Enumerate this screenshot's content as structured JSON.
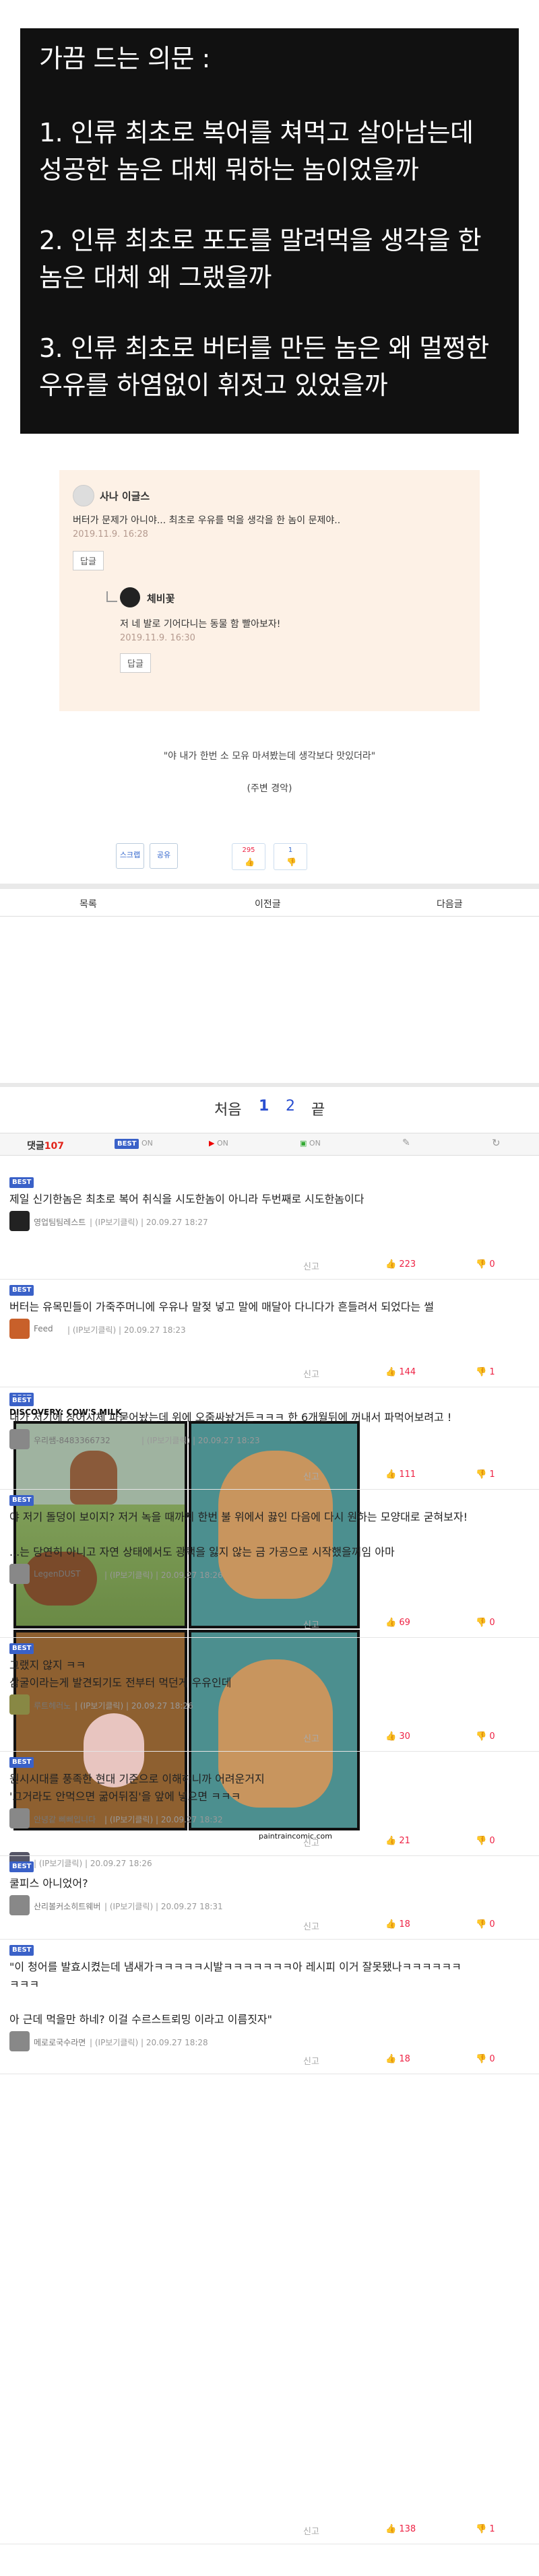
{
  "top_card": {
    "lines": [
      "가끔 드는 의문 :",
      "1. 인류 최초로 복어를 쳐먹고 살아남는데",
      "성공한 놈은 대체 뭐하는 놈이었을까",
      "2. 인류 최초로 포도를 말려먹을 생각을 한",
      "놈은 대체 왜 그랬을까",
      "3. 인류 최초로 버터를 만든 놈은 왜 멀쩡한",
      "우유를 하염없이 휘젓고 있었을까"
    ]
  },
  "comment_box": {
    "c1": {
      "name": "사나 이글스",
      "text": "버터가 문제가 아니야... 최초로 우유를 먹을 생각을 한 놈이 문제야..",
      "date": "2019.11.9. 16:28",
      "reply": "답글"
    },
    "c2": {
      "name": "체비꽃",
      "text": "저 네 발로 기어다니는 동물 함 빨아보자!",
      "date": "2019.11.9. 16:30",
      "reply": "답글"
    }
  },
  "quote": "\"야 내가 한번 소 모유 마셔봤는데 생각보다 맛있더라\"",
  "quote_src": "(주변 경악)",
  "buttons": {
    "scrap": "스크랩",
    "share": "공유",
    "up_count": "295",
    "down_count": "1"
  },
  "nav": {
    "list": "목록",
    "prev": "이전글",
    "next": "다음글"
  },
  "pager": {
    "first": "처음",
    "p1": "1",
    "p2": "2",
    "last": "끝"
  },
  "tabs": {
    "comments_label": "댓글",
    "comments_count": "107",
    "best": "BEST",
    "on1": "ON",
    "on2": "ON",
    "on3": "ON"
  },
  "best_badge": "BEST",
  "report": "신고",
  "comments": [
    {
      "text": "제일 신기한놈은 최초로 복어 취식을 시도한놈이 아니라 두번째로 시도한놈이다",
      "nick": "영업팀팀레스트",
      "meta": "| (IP보기클릭) | 20.09.27 18:27",
      "up": "223",
      "down": "0"
    },
    {
      "text": "버터는 유목민들이 가죽주머니에 우유나 말젖 넣고 말에 매달아 다니다가 흔들려서 되었다는 썰",
      "nick": "Feed",
      "meta": "| (IP보기클릭) | 20.09.27 18:23",
      "up": "144",
      "down": "1"
    },
    {
      "nick": "",
      "meta": "| (IP보기클릭) | 20.09.27 18:26",
      "up": "138",
      "down": "1",
      "comic_title": "DISCOVERY: COW'S MILK",
      "comic_credit": "paintraincomic.com"
    },
    {
      "text": "내가 저기에 상어시체 파묻어놨는데 위에 오줌싸놨거든ㅋㅋㅋ 한 6개월뒤에 꺼내서 파먹어보려고 !",
      "nick": "우리쌤-8483366732",
      "meta": "| (IP보기클릭) | 20.09.27 18:23",
      "up": "111",
      "down": "1"
    },
    {
      "text": "야 저기 돌덩이 보이지? 저거 녹을 때까지 한번 불 위에서 끓인 다음에 다시 원하는 모양대로 굳혀보자!\n\n...는 당연히 아니고 자연 상태에서도 광택을 잃지 않는 금 가공으로 시작했을꺼임 아마",
      "nick": "LegenDUST",
      "meta": "| (IP보기클릭) | 20.09.27 18:26",
      "up": "69",
      "down": "0"
    },
    {
      "text": "그랬지 않지 ㅋㅋ\n삼굴이라는게 발견되기도 전부터 먹던게 우유인데",
      "nick": "루트헤러노",
      "meta": "| (IP보기클릭) | 20.09.27 18:26",
      "up": "30",
      "down": "0"
    },
    {
      "text": "원시시대를 풍족한 현대 기준으로 이해하니까 어려운거지\n'그거라도 안먹으면 굶어뒤짐'을 앞에 넣으면 ㅋㅋㅋ",
      "nick": "안녕같 삐삐입니다",
      "meta": "| (IP보기클릭) | 20.09.27 18:32",
      "up": "21",
      "down": "0"
    },
    {
      "text": "쿨피스 아니었어?",
      "nick": "산리볼커소히트웨버",
      "meta": "| (IP보기클릭) | 20.09.27 18:31",
      "up": "18",
      "down": "0"
    },
    {
      "text": "\"이 청어를 발효시켰는데 냄새가ㅋㅋㅋㅋㅋ시발ㅋㅋㅋㅋㅋㅋㅋ아 레시피 이거 잘못됐나ㅋㅋㅋㅋㅋㅋ\nㅋㅋㅋ\n\n아 근데 먹을만 하네? 이걸 수르스트뢰밍 이라고 이름짓자\"",
      "nick": "메로로국수라면",
      "meta": "| (IP보기클릭) | 20.09.27 18:28",
      "up": "18",
      "down": "0"
    }
  ],
  "colors": {
    "accent": "#3a61c8",
    "comment_count": "#e2231a",
    "up": "#e24",
    "best_bg": "#3a61c8"
  }
}
